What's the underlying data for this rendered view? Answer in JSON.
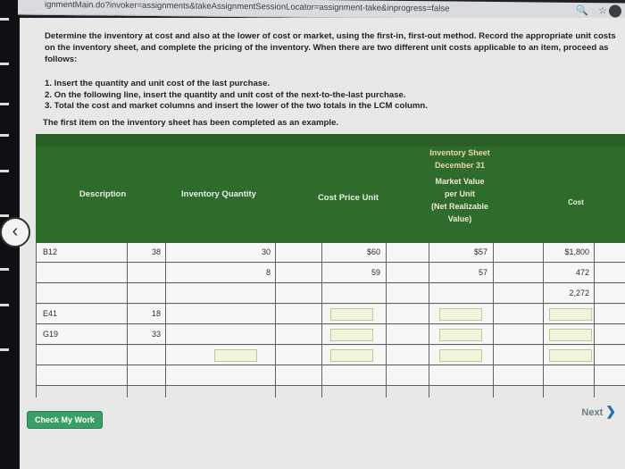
{
  "browser": {
    "url": "ignmentMain.do?invoker=assignments&takeAssignmentSessionLocator=assignment-take&inprogress=false"
  },
  "instructions": {
    "intro": "Determine the inventory at cost and also at the lower of cost or market, using the first-in, first-out method. Record the appropriate unit costs on the inventory sheet, and complete the pricing of the inventory. When there are two different unit costs applicable to an item, proceed as follows:",
    "step1": "1. Insert the quantity and unit cost of the last purchase.",
    "step2": "2. On the following line, insert the quantity and unit cost of the next-to-the-last purchase.",
    "step3": "3. Total the cost and market columns and insert the lower of the two totals in the LCM column.",
    "example_note": "The first item on the inventory sheet has been completed as an example."
  },
  "sheet": {
    "title_line1": "Inventory Sheet",
    "title_line2": "December 31",
    "headers": {
      "description": "Description",
      "quantity": "Inventory Quantity",
      "cost_price": "Cost Price Unit",
      "market_line1": "Market Value",
      "market_line2": "per Unit",
      "market_line3": "(Net Realizable",
      "market_line4": "Value)",
      "cost": "Cost"
    },
    "rows": [
      {
        "description": "B12",
        "quantity": "38",
        "qty_split": "30",
        "unit_cost": "$60",
        "market": "$57",
        "cost": "$1,800"
      },
      {
        "description": "",
        "quantity": "",
        "qty_split": "8",
        "unit_cost": "59",
        "market": "57",
        "cost": "472"
      },
      {
        "description": "",
        "quantity": "",
        "qty_split": "",
        "unit_cost": "",
        "market": "",
        "cost": "2,272"
      },
      {
        "description": "E41",
        "quantity": "18",
        "qty_split": "",
        "unit_cost": "",
        "market": "",
        "cost": ""
      },
      {
        "description": "G19",
        "quantity": "33",
        "qty_split": "",
        "unit_cost": "",
        "market": "",
        "cost": ""
      },
      {
        "description": "",
        "quantity": "",
        "qty_split": "",
        "unit_cost": "",
        "market": "",
        "cost": ""
      },
      {
        "description": "",
        "quantity": "",
        "qty_split": "",
        "unit_cost": "",
        "market": "",
        "cost": ""
      }
    ]
  },
  "buttons": {
    "check": "Check My Work",
    "next": "Next"
  },
  "colors": {
    "header_green": "#2f6b2a",
    "check_button": "#3a9e68"
  }
}
